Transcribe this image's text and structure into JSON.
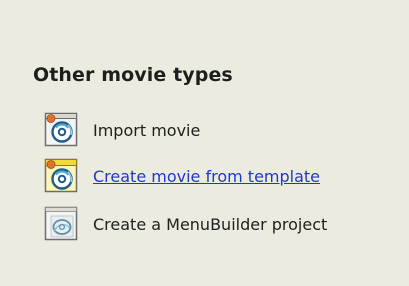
{
  "section": {
    "title": "Other movie types"
  },
  "items": [
    {
      "label": "Import movie",
      "icon": "movie-reel-icon",
      "is_link": false
    },
    {
      "label": "Create movie from template",
      "icon": "template-movie-icon",
      "is_link": true
    },
    {
      "label": "Create a MenuBuilder project",
      "icon": "menubuilder-icon",
      "is_link": false
    }
  ],
  "colors": {
    "background": "#ecebe0",
    "link": "#1d39c9",
    "text": "#202020"
  }
}
